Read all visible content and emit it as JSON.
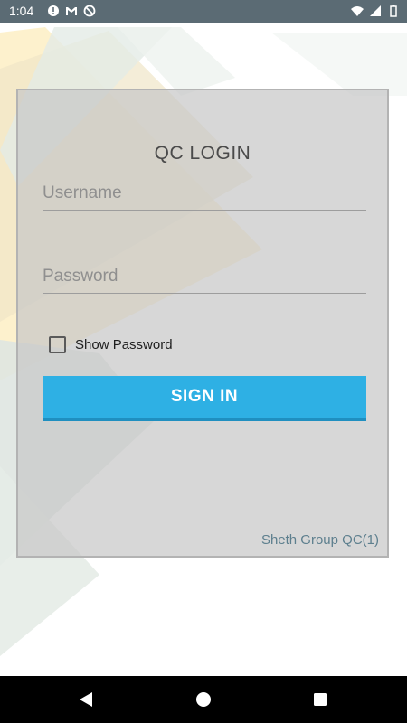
{
  "status_bar": {
    "time": "1:04",
    "left_icons": [
      "alert-circle-icon",
      "gmail-icon",
      "sync-disabled-icon"
    ],
    "right_icons": [
      "wifi-icon",
      "signal-icon",
      "battery-icon"
    ]
  },
  "login": {
    "title": "QC LOGIN",
    "username_placeholder": "Username",
    "password_placeholder": "Password",
    "show_password_label": "Show Password",
    "show_password_checked": false,
    "sign_in_label": "SIGN IN",
    "footer": "Sheth Group QC(1)"
  },
  "nav_bar": {
    "buttons": [
      "back-icon",
      "home-icon",
      "recents-icon"
    ]
  },
  "colors": {
    "status_bar": "#5b6b74",
    "accent": "#2eb0e4",
    "footer_text": "#5d7f8e"
  }
}
